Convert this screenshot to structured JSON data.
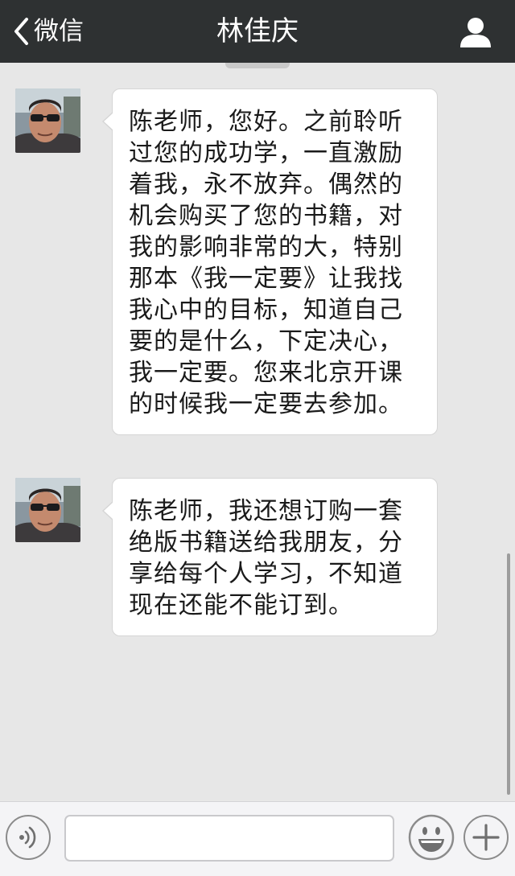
{
  "header": {
    "back_label": "微信",
    "title": "林佳庆"
  },
  "icons": {
    "back": "chevron-left-icon",
    "profile": "person-icon",
    "voice": "voice-icon",
    "emoji": "smiley-icon",
    "more": "plus-icon"
  },
  "colors": {
    "navbar": "#2e3132",
    "chat_background": "#e7e7e7",
    "bubble": "#ffffff"
  },
  "messages": [
    {
      "sender": "林佳庆",
      "lines": [
        "陈老师，您好。之前聆听",
        "过您的成功学，一直激励",
        "着我，永不放弃。偶然的",
        "机会购买了您的书籍，对",
        "我的影响非常的大，特别",
        "那本《我一定要》让我找",
        "我心中的目标，知道自己",
        "要的是什么，下定决心，",
        "我一定要。您来北京开课",
        "的时候我一定要去参加。"
      ]
    },
    {
      "sender": "林佳庆",
      "lines": [
        "陈老师，我还想订购一套",
        "绝版书籍送给我朋友，分",
        "享给每个人学习，不知道",
        "现在还能不能订到。"
      ]
    }
  ],
  "input": {
    "value": "",
    "placeholder": ""
  }
}
